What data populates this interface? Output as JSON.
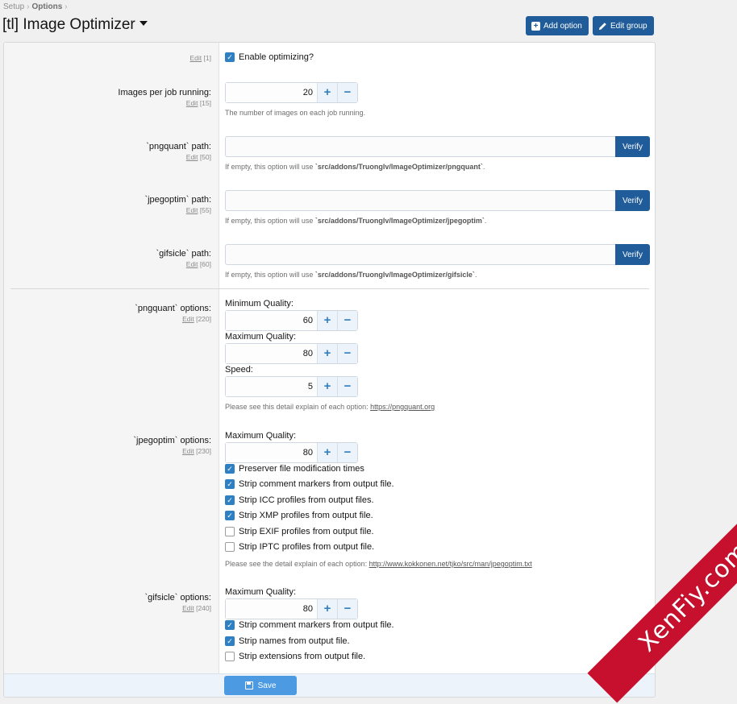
{
  "breadcrumb": {
    "items": [
      "Setup",
      "Options"
    ],
    "separator": "›"
  },
  "page": {
    "title": "[tl] Image Optimizer"
  },
  "header_buttons": {
    "add_option": "Add option",
    "edit_group": "Edit group"
  },
  "edit_label": "Edit",
  "rows": {
    "enable": {
      "edit_id": "[1]",
      "checkbox_label": "Enable optimizing?",
      "checked": true
    },
    "images_per_job": {
      "label": "Images per job running:",
      "edit_id": "[15]",
      "value": "20",
      "hint": "The number of images on each job running."
    },
    "pngquant_path": {
      "label": "`pngquant` path:",
      "edit_id": "[50]",
      "value": "",
      "verify": "Verify",
      "hint_prefix": "If empty, this option will use ",
      "hint_path": "`src/addons/Truonglv/ImageOptimizer/pngquant`",
      "hint_suffix": "."
    },
    "jpegoptim_path": {
      "label": "`jpegoptim` path:",
      "edit_id": "[55]",
      "value": "",
      "verify": "Verify",
      "hint_prefix": "If empty, this option will use ",
      "hint_path": "`src/addons/Truonglv/ImageOptimizer/jpegoptim`",
      "hint_suffix": "."
    },
    "gifsicle_path": {
      "label": "`gifsicle` path:",
      "edit_id": "[60]",
      "value": "",
      "verify": "Verify",
      "hint_prefix": "If empty, this option will use ",
      "hint_path": "`src/addons/Truonglv/ImageOptimizer/gifsicle`",
      "hint_suffix": "."
    },
    "pngquant_options": {
      "label": "`pngquant` options:",
      "edit_id": "[220]",
      "min_quality_label": "Minimum Quality:",
      "min_quality": "60",
      "max_quality_label": "Maximum Quality:",
      "max_quality": "80",
      "speed_label": "Speed:",
      "speed": "5",
      "hint_prefix": "Please see this detail explain of each option: ",
      "hint_link": "https://pngquant.org"
    },
    "jpegoptim_options": {
      "label": "`jpegoptim` options:",
      "edit_id": "[230]",
      "max_quality_label": "Maximum Quality:",
      "max_quality": "80",
      "checkboxes": [
        {
          "label": "Preserver file modification times",
          "checked": true
        },
        {
          "label": "Strip comment markers from output file.",
          "checked": true
        },
        {
          "label": "Strip ICC profiles from output files.",
          "checked": true
        },
        {
          "label": "Strip XMP profiles from output file.",
          "checked": true
        },
        {
          "label": "Strip EXIF profiles from output file.",
          "checked": false
        },
        {
          "label": "Strip IPTC profiles from output file.",
          "checked": false
        }
      ],
      "hint_prefix": "Please see the detail explain of each option: ",
      "hint_link": "http://www.kokkonen.net/tjko/src/man/jpegoptim.txt"
    },
    "gifsicle_options": {
      "label": "`gifsicle` options:",
      "edit_id": "[240]",
      "max_quality_label": "Maximum Quality:",
      "max_quality": "80",
      "checkboxes": [
        {
          "label": "Strip comment markers from output file.",
          "checked": true
        },
        {
          "label": "Strip names from output file.",
          "checked": true
        },
        {
          "label": "Strip extensions from output file.",
          "checked": false
        }
      ]
    }
  },
  "save_button": "Save",
  "watermark": "XenFiy.com",
  "icons": {
    "plus": "+",
    "minus": "−",
    "check": "✓"
  },
  "colors": {
    "primary": "#1f5c99",
    "checkbox": "#2f7fc3",
    "save": "#4c9be2",
    "watermark": "#c7102e"
  }
}
